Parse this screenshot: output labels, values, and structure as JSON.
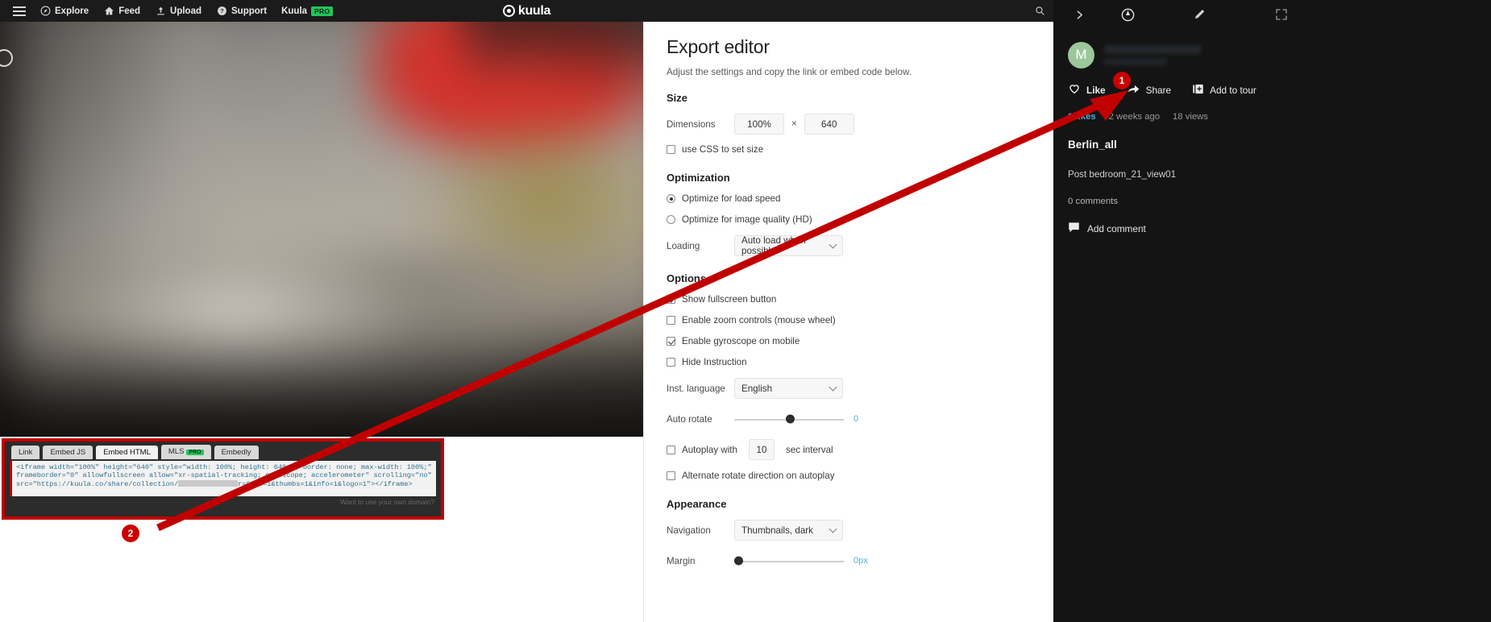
{
  "topbar": {
    "menu_icon": "hamburger-icon",
    "items": [
      {
        "label": "Explore",
        "icon": "compass-icon"
      },
      {
        "label": "Feed",
        "icon": "home-icon"
      },
      {
        "label": "Upload",
        "icon": "upload-icon"
      },
      {
        "label": "Support",
        "icon": "question-circle-icon"
      }
    ],
    "account_label": "Kuula",
    "pro_badge": "PRO",
    "logo_text": "kuula"
  },
  "editor": {
    "title": "Export editor",
    "subtitle": "Adjust the settings and copy the link or embed code below.",
    "size": {
      "heading": "Size",
      "dimensions_label": "Dimensions",
      "width_value": "100%",
      "separator": "×",
      "height_value": "640",
      "css_checkbox_label": "use CSS to set size",
      "css_checked": false
    },
    "optimization": {
      "heading": "Optimization",
      "options": [
        {
          "label": "Optimize for load speed",
          "selected": true
        },
        {
          "label": "Optimize for image quality (HD)",
          "selected": false
        }
      ],
      "loading_label": "Loading",
      "loading_value": "Auto load when possible"
    },
    "options": {
      "heading": "Options",
      "checkboxes": [
        {
          "label": "Show fullscreen button",
          "checked": true
        },
        {
          "label": "Enable zoom controls (mouse wheel)",
          "checked": false
        },
        {
          "label": "Enable gyroscope on mobile",
          "checked": true
        },
        {
          "label": "Hide Instruction",
          "checked": false
        }
      ],
      "language_label": "Inst. language",
      "language_value": "English",
      "autorotate_label": "Auto rotate",
      "autorotate_value": "0",
      "autoplay_label": "Autoplay with",
      "autoplay_checked": false,
      "autoplay_interval": "10",
      "autoplay_suffix": "sec interval",
      "alternate_label": "Alternate rotate direction on autoplay",
      "alternate_checked": false
    },
    "appearance": {
      "heading": "Appearance",
      "navigation_label": "Navigation",
      "navigation_value": "Thumbnails, dark",
      "margin_label": "Margin",
      "margin_value": "0px"
    }
  },
  "embed": {
    "tabs": [
      {
        "label": "Link",
        "active": false,
        "pro": false
      },
      {
        "label": "Embed JS",
        "active": false,
        "pro": false
      },
      {
        "label": "Embed HTML",
        "active": true,
        "pro": false
      },
      {
        "label": "MLS",
        "active": false,
        "pro": true,
        "pro_badge": "PRO"
      },
      {
        "label": "Embedly",
        "active": false,
        "pro": false
      }
    ],
    "code_part1": "<iframe width=\"100%\" height=\"640\" style=\"width: 100%; height: 640px; border: none; max-width: 100%;\" frameborder=\"0\" allowfullscreen allow=\"xr-spatial-tracking; gyroscope; accelerometer\" scrolling=\"no\" src=\"https://kuula.co/share/collection/",
    "code_part2": "r=0&sd=1&thumbs=1&info=1&logo=1\"></iframe>",
    "own_domain_text": "Want to use your own domain?"
  },
  "sidebar": {
    "top_icons": [
      {
        "name": "chevron-right-icon"
      },
      {
        "name": "compass-icon"
      },
      {
        "name": "pencil-icon"
      },
      {
        "name": "fullscreen-icon"
      }
    ],
    "avatar_initial": "M",
    "actions": [
      {
        "label": "Like",
        "icon": "heart-icon"
      },
      {
        "label": "Share",
        "icon": "share-arrow-icon"
      },
      {
        "label": "Add to tour",
        "icon": "add-to-tour-icon"
      }
    ],
    "stats": {
      "likes": "0 likes",
      "time": "2 weeks ago",
      "views": "18 views"
    },
    "collection_title": "Berlin_all",
    "post_title": "Post bedroom_21_view01",
    "comments_count": "0 comments",
    "add_comment_label": "Add comment"
  },
  "annotations": {
    "marker_1": "1",
    "marker_2": "2",
    "arrow_color": "#c00000"
  }
}
